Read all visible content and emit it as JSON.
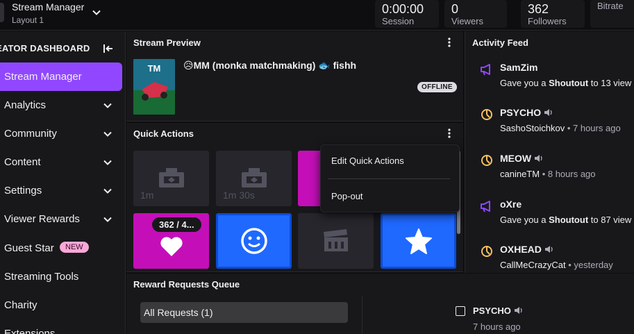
{
  "header": {
    "title": "Stream Manager",
    "layout": "Layout 1",
    "stats": [
      {
        "value": "0:00:00",
        "label": "Session"
      },
      {
        "value": "0",
        "label": "Viewers"
      },
      {
        "value": "362",
        "label": "Followers"
      },
      {
        "value": "",
        "label": "Bitrate"
      }
    ]
  },
  "sidebar": {
    "header": "EATOR DASHBOARD",
    "items": [
      {
        "label": "Stream Manager",
        "active": true
      },
      {
        "label": "Analytics"
      },
      {
        "label": "Community"
      },
      {
        "label": "Content"
      },
      {
        "label": "Settings"
      },
      {
        "label": "Viewer Rewards"
      },
      {
        "label": "Guest Star",
        "badge": "NEW"
      },
      {
        "label": "Streaming Tools"
      },
      {
        "label": "Charity"
      },
      {
        "label": "Extensions"
      }
    ]
  },
  "stream_preview": {
    "title": "Stream Preview",
    "stream_title": "😥MM (monka matchmaking) 🐟 fishh",
    "status": "OFFLINE"
  },
  "quick_actions": {
    "title": "Quick Actions",
    "tiles": [
      {
        "sub": "1m"
      },
      {
        "sub": "1m 30s"
      },
      {
        "sub": ""
      },
      {
        "pill": "362 / 4..."
      },
      {
        "sub": ""
      },
      {
        "sub": ""
      },
      {
        "sub": ""
      }
    ],
    "menu": {
      "edit": "Edit Quick Actions",
      "popout": "Pop-out"
    }
  },
  "activity_feed": {
    "title": "Activity Feed",
    "items": [
      {
        "name": "SamZim",
        "line_pre": "Gave you a ",
        "line_bold": "Shoutout",
        "line_post": " to 13 view",
        "meta": ""
      },
      {
        "name": "PSYCHO",
        "line_pre": "SashoStoichkov",
        "line_bold": "",
        "line_post": "",
        "meta": " • 7 hours ago"
      },
      {
        "name": "MEOW",
        "line_pre": "canineTM",
        "line_bold": "",
        "line_post": "",
        "meta": " • 8 hours ago"
      },
      {
        "name": "oXre",
        "line_pre": "Gave you a ",
        "line_bold": "Shoutout",
        "line_post": " to 87 view",
        "meta": ""
      },
      {
        "name": "OXHEAD",
        "line_pre": "CallMeCrazyCat",
        "line_bold": "",
        "line_post": "",
        "meta": " • yesterday"
      }
    ]
  },
  "reward_queue": {
    "title": "Reward Requests Queue",
    "filter": "All Requests (1)",
    "request_name": "PSYCHO",
    "request_time": "7 hours ago"
  },
  "colors": {
    "accent": "#9147ff",
    "tile_pink": "#c40fb8",
    "tile_blue": "#1f69ff",
    "badge": "#f9a8d8"
  }
}
